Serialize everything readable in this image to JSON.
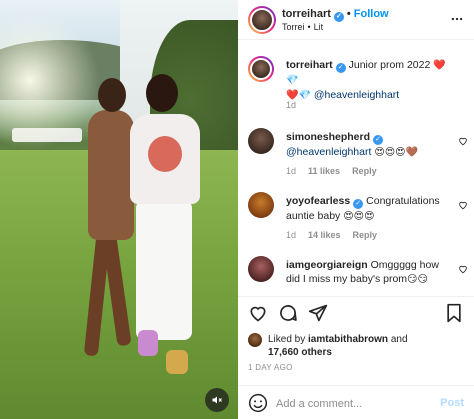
{
  "header": {
    "username": "torreihart",
    "follow_label": "Follow",
    "subtitle_name": "Torrei",
    "subtitle_audio": "Lit"
  },
  "caption": {
    "username": "torreihart",
    "text": "Junior prom 2022",
    "emojis": "❤️💎",
    "line2_emojis": "❤️💎",
    "mention": "@heavenleighhart",
    "time": "1d"
  },
  "comments": [
    {
      "username": "simoneshepherd",
      "mention": "@heavenleighhart",
      "text": "",
      "emojis": "😍😍😍🤎",
      "time": "1d",
      "likes": "11 likes",
      "reply": "Reply"
    },
    {
      "username": "yoyofearless",
      "mention": "",
      "text": "Congratulations auntie baby",
      "emojis": "😍😍😍",
      "time": "1d",
      "likes": "14 likes",
      "reply": "Reply"
    },
    {
      "username": "iamgeorgiareign",
      "mention": "",
      "text": "Omggggg how did I miss my baby's prom",
      "emojis": "😏😏",
      "time": "",
      "likes": "",
      "reply": ""
    }
  ],
  "liked_by": {
    "prefix": "Liked by",
    "user": "iamtabithabrown",
    "and": "and",
    "others": "17,660 others"
  },
  "time_ago": "1 DAY AGO",
  "add_comment": {
    "placeholder": "Add a comment...",
    "post_label": "Post"
  },
  "colors": {
    "accent": "#0095f6",
    "verified": "#3897f0",
    "mention": "#00376b",
    "muted": "#8e8e8e",
    "post_disabled": "#b3dbff"
  }
}
